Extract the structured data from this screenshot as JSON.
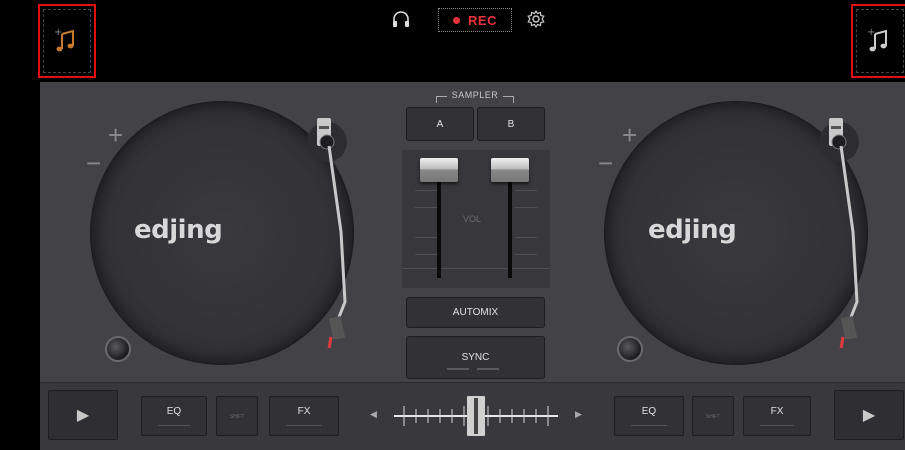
{
  "topbar": {
    "rec_label": "REC",
    "load_left_icon": "music-note-add-icon",
    "load_right_icon": "music-note-add-icon",
    "headphones_icon": "headphones-icon",
    "settings_icon": "gear-icon"
  },
  "decks": {
    "left": {
      "brand": "edjing",
      "plus": "+",
      "minus": "−"
    },
    "right": {
      "brand": "edjing",
      "plus": "+",
      "minus": "−"
    }
  },
  "mixer": {
    "sampler_label": "SAMPLER",
    "sampler_a": "A",
    "sampler_b": "B",
    "vol_label": "VOL",
    "automix_label": "AUTOMIX",
    "sync_label": "SYNC"
  },
  "bottom": {
    "left": {
      "eq_label": "EQ",
      "shift_label": "SHIFT",
      "fx_label": "FX"
    },
    "right": {
      "eq_label": "EQ",
      "shift_label": "SHIFT",
      "fx_label": "FX"
    },
    "crossfader_left_arrow": "◀",
    "crossfader_right_arrow": "▶",
    "play_glyph": "▶"
  },
  "colors": {
    "rec": "#e8323a",
    "highlight": "#e01010",
    "music_note": "#c8792a"
  }
}
